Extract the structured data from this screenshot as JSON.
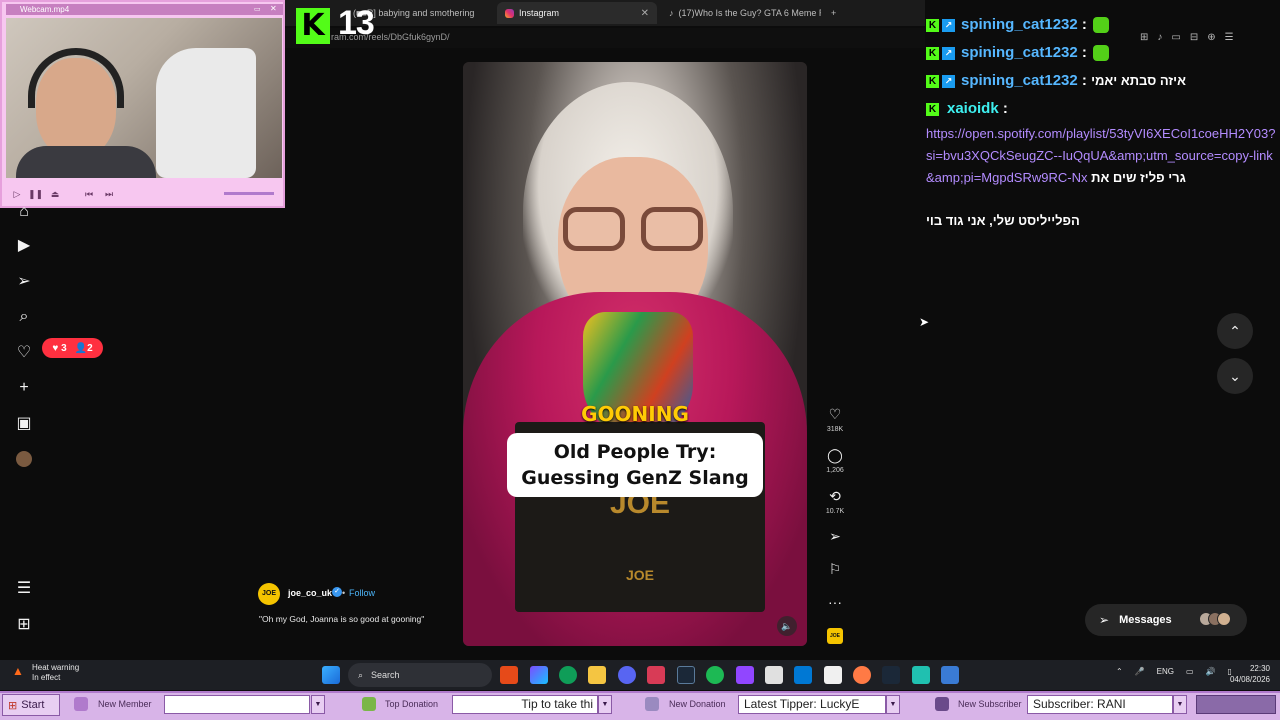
{
  "browser": {
    "tabs": [
      {
        "label": "(■■R] babying and smothering",
        "active": false
      },
      {
        "label": "Instagram",
        "active": true
      },
      {
        "label": "(17)Who Is the Guy? GTA 6 Meme Re...",
        "active": false
      }
    ],
    "new_tab": "+",
    "url": "ram.com/reels/DbGfuk6gynD/"
  },
  "kick": {
    "logo": "K",
    "viewers": "13"
  },
  "webcam": {
    "title": "Webcam.mp4"
  },
  "nav": {
    "notifications": {
      "likes": "3",
      "follows": "2"
    }
  },
  "reel": {
    "caption_top": "GOONING",
    "caption_box_line1": "Old People Try:",
    "caption_box_line2": "Guessing GenZ Slang",
    "board_text": "JOE",
    "board_text2": "JOE",
    "author": "joe_co_uk",
    "author_avatar": "JOE",
    "follow": "Follow",
    "follow_dot": "•",
    "description": "\"Oh my God, Joanna is so good at gooning\"",
    "likes": "318K",
    "comments": "1,206",
    "reposts": "10.7K",
    "side_badge": "JOE"
  },
  "chat": {
    "messages": [
      {
        "user": "spining_cat1232",
        "sep": ":"
      },
      {
        "user": "spining_cat1232",
        "sep": ":"
      },
      {
        "user": "spining_cat1232",
        "sep": ":",
        "text": "איזה סבתא יאמי"
      },
      {
        "user": "xaioidk",
        "sep": ":"
      }
    ],
    "link": "https://open.spotify.com/playlist/53tyVI6XECoI1coeHH2Y03?si=bvu3XQCkSeugZC--IuQqUA&amp;utm_source=copy-link&amp;pi=MgpdSRw9RC-Nx",
    "link_suffix": "גרי פליז שים את",
    "line2": "הפלייליסט שלי, אני גוד בוי"
  },
  "messages_button": "Messages",
  "taskbar": {
    "heat_title": "Heat warning",
    "heat_sub": "In effect",
    "search": "Search",
    "lang": "ENG",
    "time": "22:30",
    "date": "04/08/2026"
  },
  "streambar": {
    "start": "Start",
    "new_member": "New Member",
    "member_value": "",
    "top_donation": "Top Donation",
    "top_donation_value": "Tip to take thi",
    "new_donation": "New Donation",
    "latest_tipper": "Latest Tipper: LuckyE",
    "new_subscriber": "New Subscriber",
    "subscriber_value": "Subscriber: RANI"
  }
}
